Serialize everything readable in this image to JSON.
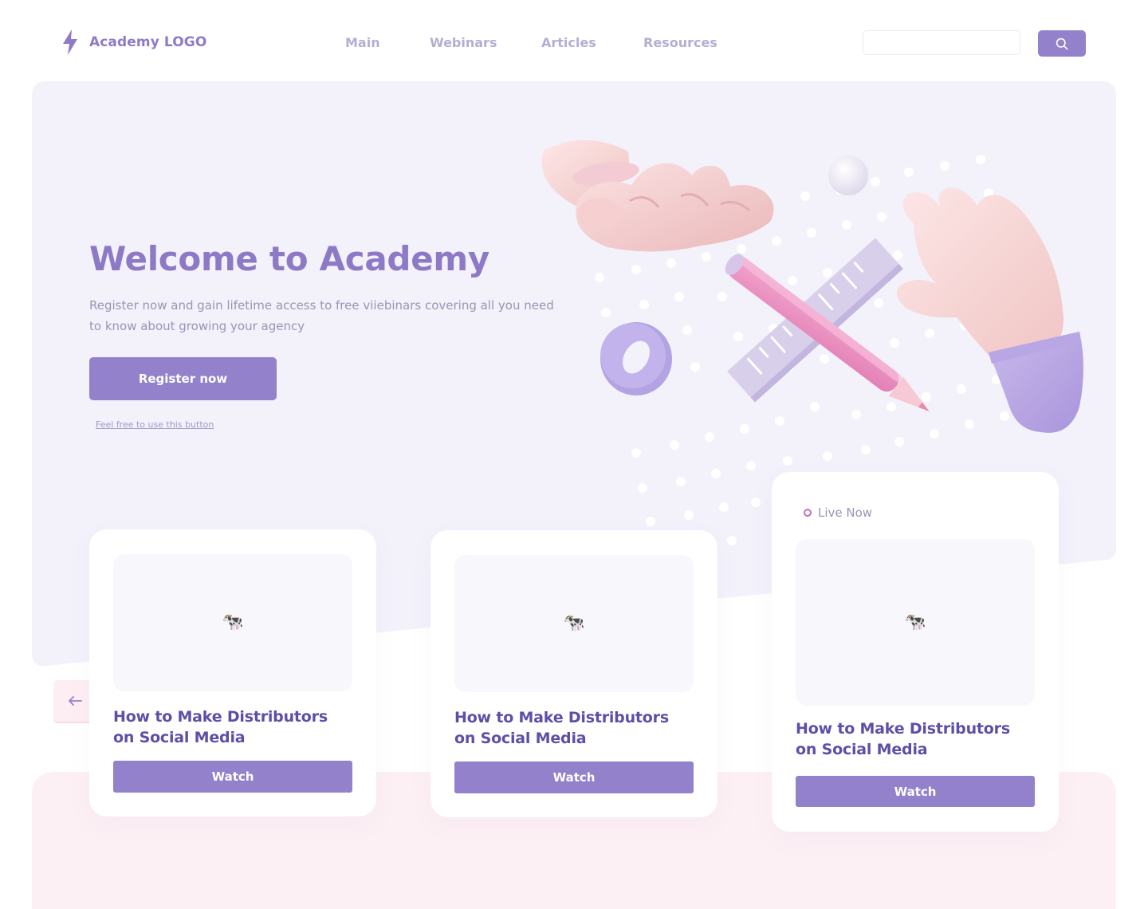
{
  "header": {
    "logo_text": "Academy LOGO",
    "nav": [
      {
        "label": "Main"
      },
      {
        "label": "Webinars"
      },
      {
        "label": "Articles"
      },
      {
        "label": "Resources"
      }
    ],
    "search_placeholder": "",
    "search_icon": "search-icon"
  },
  "hero": {
    "title": "Welcome to Academy",
    "subtitle": "Register now and gain lifetime access to free viiebinars covering all you need to know about growing your agency",
    "register_label": "Register now",
    "hint_link": "Feel free to use this button"
  },
  "carousel": {
    "prev_icon": "arrow-left-icon",
    "cards": [
      {
        "thumb": "🐄",
        "title": "How to Make Distributors on Social Media",
        "button": "Watch"
      },
      {
        "thumb": "🐄",
        "title": "How to Make Distributors on Social Media",
        "button": "Watch"
      },
      {
        "thumb": "🐄",
        "title": "How to Make Distributors on Social Media",
        "button": "Watch",
        "badge": "Live Now"
      }
    ]
  },
  "colors": {
    "accent": "#9381cb",
    "heading": "#8d79c6",
    "card_title": "#5e4fa6",
    "hero_bg": "#f3f1fa",
    "footer_bg": "#fdf0f4",
    "live_dot": "#c56fb3"
  }
}
